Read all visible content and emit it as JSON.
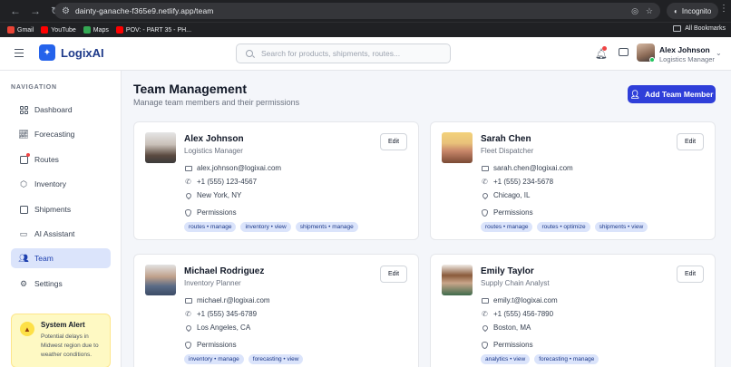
{
  "browser": {
    "url": "dainty-ganache-f365e9.netlify.app/team",
    "incognito_label": "Incognito",
    "bookmarks": [
      {
        "label": "Gmail",
        "color": "#ea4335"
      },
      {
        "label": "YouTube",
        "color": "#ff0000"
      },
      {
        "label": "Maps",
        "color": "#34a853"
      },
      {
        "label": "POV: - PART 35 - PH...",
        "color": "#ff0000"
      }
    ],
    "all_bookmarks_label": "All Bookmarks"
  },
  "header": {
    "brand": "LogixAI",
    "search_placeholder": "Search for products, shipments, routes...",
    "user_name": "Alex Johnson",
    "user_role": "Logistics Manager"
  },
  "sidebar": {
    "heading": "NAVIGATION",
    "items": [
      {
        "label": "Dashboard",
        "icon": "grid-icon"
      },
      {
        "label": "Forecasting",
        "icon": "chart-icon"
      },
      {
        "label": "Routes",
        "icon": "map-icon"
      },
      {
        "label": "Inventory",
        "icon": "box-icon"
      },
      {
        "label": "Shipments",
        "icon": "truck-icon"
      },
      {
        "label": "AI Assistant",
        "icon": "chat-icon"
      },
      {
        "label": "Team",
        "icon": "users-icon"
      },
      {
        "label": "Settings",
        "icon": "gear-icon"
      }
    ],
    "active_item": "Team",
    "alert": {
      "title": "System Alert",
      "text": "Potential delays in Midwest region due to weather conditions."
    }
  },
  "main": {
    "title": "Team Management",
    "subtitle": "Manage team members and their permissions",
    "add_button": "Add Team Member",
    "permissions_label": "Permissions",
    "edit_label": "Edit",
    "members": [
      {
        "name": "Alex Johnson",
        "role": "Logistics Manager",
        "email": "alex.johnson@logixai.com",
        "phone": "+1 (555) 123-4567",
        "location": "New York, NY",
        "tags": [
          "routes • manage",
          "inventory • view",
          "shipments • manage"
        ]
      },
      {
        "name": "Sarah Chen",
        "role": "Fleet Dispatcher",
        "email": "sarah.chen@logixai.com",
        "phone": "+1 (555) 234-5678",
        "location": "Chicago, IL",
        "tags": [
          "routes • manage",
          "routes • optimize",
          "shipments • view"
        ]
      },
      {
        "name": "Michael Rodriguez",
        "role": "Inventory Planner",
        "email": "michael.r@logixai.com",
        "phone": "+1 (555) 345-6789",
        "location": "Los Angeles, CA",
        "tags": [
          "inventory • manage",
          "forecasting • view"
        ]
      },
      {
        "name": "Emily Taylor",
        "role": "Supply Chain Analyst",
        "email": "emily.t@logixai.com",
        "phone": "+1 (555) 456-7890",
        "location": "Boston, MA",
        "tags": [
          "analytics • view",
          "forecasting • manage"
        ]
      }
    ]
  },
  "colors": {
    "accent": "#2f3fd9",
    "active_nav_bg": "#dbe4fb",
    "tag_bg": "#dbe4fb",
    "alert_bg": "#fef9c3"
  }
}
